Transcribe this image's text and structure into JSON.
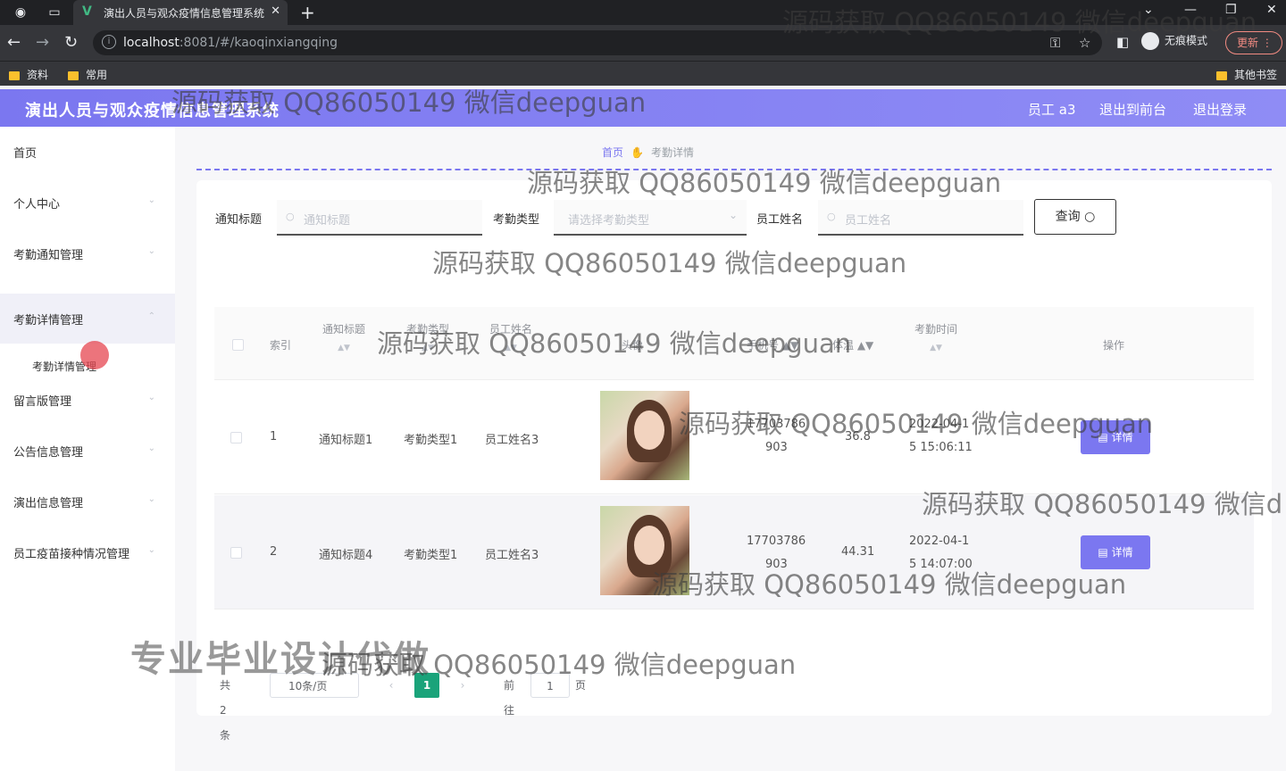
{
  "browser": {
    "tab_title": "演出人员与观众疫情信息管理系统",
    "url_host": "localhost",
    "url_rest": ":8081/#/kaoqinxiangqing",
    "incognito_label": "无痕模式",
    "update_label": "更新",
    "bookmarks": [
      "资料",
      "常用"
    ],
    "other_bookmarks": "其他书签"
  },
  "header": {
    "title": "演出人员与观众疫情信息管理系统",
    "user": "员工 a3",
    "back_front": "退出到前台",
    "logout": "退出登录"
  },
  "sidebar": {
    "items": [
      "首页",
      "个人中心",
      "考勤通知管理",
      "考勤详情管理",
      "留言版管理",
      "公告信息管理",
      "演出信息管理",
      "员工疫苗接种情况管理"
    ],
    "sub_item": "考勤详情管理"
  },
  "breadcrumb": {
    "home": "首页",
    "current": "考勤详情"
  },
  "filters": {
    "title_label": "通知标题",
    "title_placeholder": "通知标题",
    "type_label": "考勤类型",
    "type_placeholder": "请选择考勤类型",
    "name_label": "员工姓名",
    "name_placeholder": "员工姓名",
    "query_label": "查询"
  },
  "table": {
    "headers": {
      "index": "索引",
      "title": "通知标题",
      "type": "考勤类型",
      "name": "员工姓名",
      "photo": "头像",
      "phone": "手机号",
      "temp": "体温",
      "time": "考勤时间",
      "action": "操作"
    },
    "rows": [
      {
        "index": "1",
        "title": "通知标题1",
        "type": "考勤类型1",
        "name": "员工姓名3",
        "phone_1": "17703786",
        "phone_2": "903",
        "temp": "36.8",
        "time_1": "2022-04-1",
        "time_2": "5 15:06:11",
        "action": "详情"
      },
      {
        "index": "2",
        "title": "通知标题4",
        "type": "考勤类型1",
        "name": "员工姓名3",
        "phone_1": "17703786",
        "phone_2": "903",
        "temp": "44.31",
        "time_1": "2022-04-1",
        "time_2": "5 14:07:00",
        "action": "详情"
      }
    ]
  },
  "pagination": {
    "total": "共 2 条",
    "page_size": "10条/页",
    "current": "1",
    "goto_label": "前往",
    "goto_value": "1",
    "page_unit": "页"
  },
  "watermark": {
    "text": "源码获取 QQ86050149 微信deepguan",
    "partial": "源码获取 QQ86050149 微信d",
    "big": "专业毕业设计代做"
  },
  "colors": {
    "accent": "#7b77f0",
    "pager_active": "#1aa37a"
  }
}
